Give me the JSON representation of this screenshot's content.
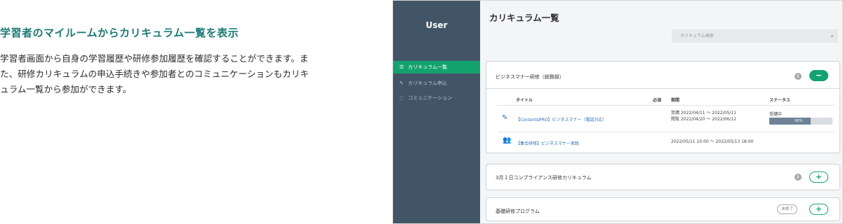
{
  "description": {
    "heading": "学習者のマイルームからカリキュラム一覧を表示",
    "body": "学習者画面から自身の学習履歴や研修参加履歴を確認することができます。また、研修カリキュラムの申込手続きや参加者とのコミュニケーションもカリキュラム一覧から参加ができます。"
  },
  "sidebar": {
    "user_label": "User",
    "items": [
      {
        "label": "カリキュラム一覧",
        "icon": "list-icon",
        "active": true
      },
      {
        "label": "カリキュラム申込",
        "icon": "edit-icon",
        "active": false
      },
      {
        "label": "コミュニケーション",
        "icon": "chat-icon",
        "active": false
      }
    ]
  },
  "header": {
    "title": "カリキュラム一覧",
    "search_placeholder": "カリキュラム検索"
  },
  "curricula": [
    {
      "title": "ビジネスマナー研修（総務部）",
      "expanded": true,
      "table": {
        "headers": {
          "title": "タイトル",
          "required": "必須",
          "period": "期間",
          "status": "ステータス"
        },
        "rows": [
          {
            "type": "e-learning",
            "icon": "edit-note-icon",
            "title": "【ContentsPRO】ビジネスマナー（電話対応）",
            "period_line1": "受講  2022/04/11 ～ 2022/05/11",
            "period_line2": "閲覧  2022/04/20 ～ 2022/06/12",
            "status": "受講中",
            "progress": 66,
            "progress_label": "66%"
          },
          {
            "type": "group-training",
            "icon": "people-icon",
            "title": "【集合研修】ビジネスマナー実践",
            "period_line1": "2022/05/11 10:00 ～ 2022/05/13 18:00"
          }
        ]
      }
    },
    {
      "title": "3月１日コンプライアンス研修カリキュラム",
      "expanded": false
    },
    {
      "title": "基礎研修プログラム",
      "expanded": false,
      "badge": "未修了"
    }
  ],
  "colors": {
    "accent": "#13a36f",
    "sidebar": "#425567",
    "heading": "#1a7a76",
    "link": "#2d6fb7"
  }
}
